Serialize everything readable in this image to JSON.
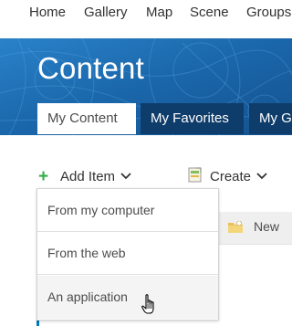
{
  "nav": {
    "items": [
      {
        "label": "Home"
      },
      {
        "label": "Gallery"
      },
      {
        "label": "Map"
      },
      {
        "label": "Scene"
      },
      {
        "label": "Groups"
      }
    ]
  },
  "page": {
    "title": "Content"
  },
  "tabs": [
    {
      "label": "My Content",
      "active": true
    },
    {
      "label": "My Favorites",
      "active": false
    },
    {
      "label": "My G",
      "active": false
    }
  ],
  "toolbar": {
    "add_item_label": "Add Item",
    "create_label": "Create",
    "new_label": "New"
  },
  "add_item_menu": {
    "items": [
      {
        "label": "From my computer"
      },
      {
        "label": "From the web"
      },
      {
        "label": "An application",
        "hovered": true
      }
    ]
  },
  "colors": {
    "banner": "#1c6bb1",
    "tab_inactive": "#0f3d6b",
    "plus_icon": "#35ac46",
    "accent": "#0079c1"
  },
  "icons": {
    "add": "plus-icon",
    "dropdown": "chevron-down-icon",
    "create": "create-document-icon",
    "folder": "new-folder-icon",
    "pointer": "hand-pointer-icon"
  }
}
